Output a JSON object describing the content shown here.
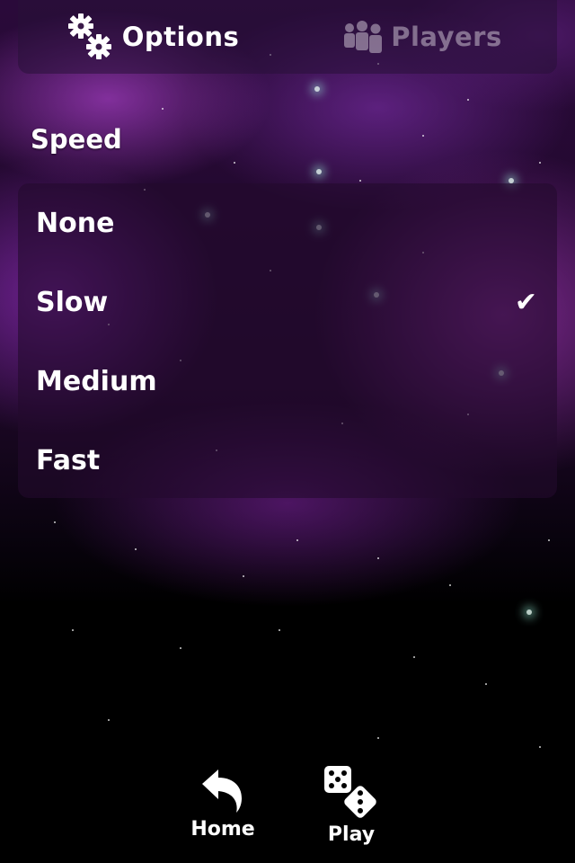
{
  "tabs": [
    {
      "label": "Options",
      "icon": "gears-icon",
      "active": true
    },
    {
      "label": "Players",
      "icon": "players-icon",
      "active": false
    }
  ],
  "section": {
    "title": "Speed"
  },
  "speed_options": [
    {
      "label": "None",
      "selected": false
    },
    {
      "label": "Slow",
      "selected": true
    },
    {
      "label": "Medium",
      "selected": false
    },
    {
      "label": "Fast",
      "selected": false
    }
  ],
  "checkmark": "✔",
  "bottom_bar": {
    "home_label": "Home",
    "play_label": "Play"
  },
  "colors": {
    "accent_purple": "#8e3aa8",
    "background_black": "#000000",
    "text_white": "#ffffff",
    "inactive_text": "#c8bece"
  }
}
